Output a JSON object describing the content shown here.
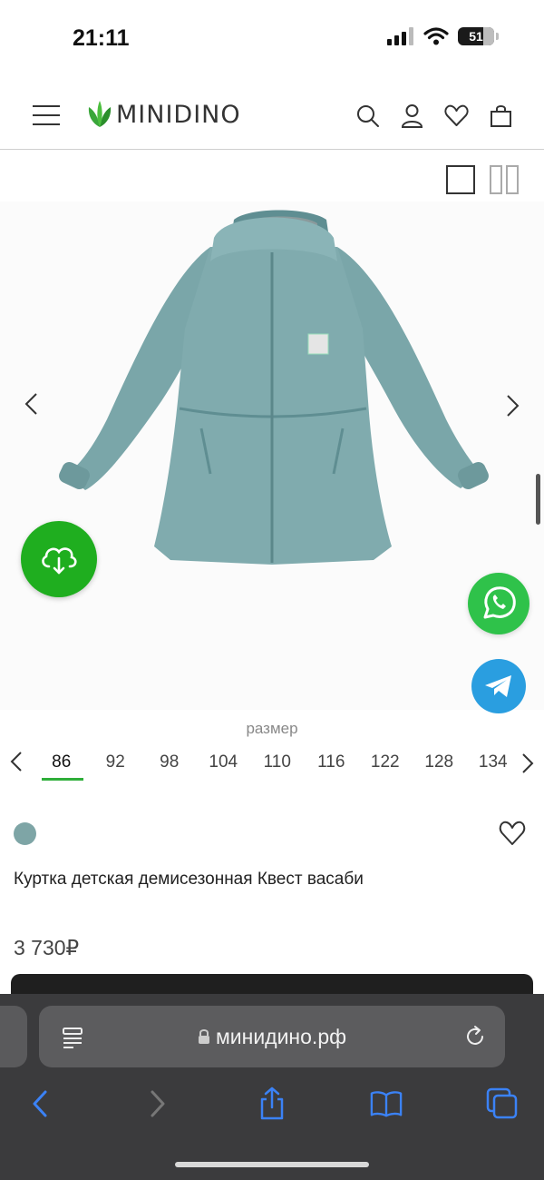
{
  "status_bar": {
    "time": "21:11",
    "battery": "51"
  },
  "header": {
    "logo_text": "MINIDINO",
    "icons": [
      "menu-icon",
      "search-icon",
      "user-icon",
      "heart-icon",
      "bag-icon"
    ]
  },
  "gallery": {
    "image_alt": "Blue-grey children's demi-season jacket with hood"
  },
  "size_selector": {
    "label": "размер",
    "sizes": [
      "86",
      "92",
      "98",
      "104",
      "110",
      "116",
      "122",
      "128",
      "134"
    ],
    "selected": "86"
  },
  "product": {
    "color_hex": "#7ea5a6",
    "title": "Куртка детская демисезонная Квест васаби",
    "price": "3 730₽"
  },
  "browser": {
    "url": "минидино.рф"
  },
  "colors": {
    "accent_green": "#2fae3a",
    "download_green": "#1fae1f",
    "whatsapp": "#2fc24a",
    "telegram": "#2a9ee0",
    "browser_chrome": "#3b3b3d",
    "ios_blue": "#3b82f6"
  }
}
